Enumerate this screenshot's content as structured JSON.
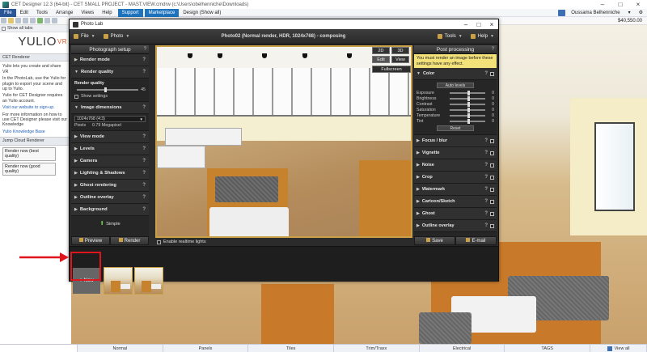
{
  "app": {
    "title": "CET Designer 12.3 (64-bit) - CET SMALL PROJECT - MAST.VIEW.cmdrw (c:\\Users\\obelhenniche\\Downloads)",
    "menus": [
      "File",
      "Edit",
      "Tools",
      "Arrange",
      "Views",
      "Help"
    ],
    "support_label": "Support",
    "marketplace_label": "Marketplace",
    "design_label": "Design (Show all)",
    "user_name": "Oussama Belhenniche",
    "amount": "$40,550.00",
    "show_all_tabs": "Show all tabs"
  },
  "left_panel": {
    "logo": "YULIO",
    "logo_suffix": "VR",
    "cet_renderer_header": "CET Renderer",
    "intro": "Yulio lets you create and share VR",
    "photolab_text": "In the PhotoLab, use the Yulio for plugin to export your scene and up to Yulio.",
    "requires_text": "Yulio for CET Designer requires an Yulio account.",
    "visit_link": "Visit our website to sign-up.",
    "more_info": "For more information on how to use CET Designer please visit our Knowledge",
    "kb_link": "Yulio Knowledge Base",
    "jump_header": "Jump Cloud Renderer",
    "render_best": "Render now (best quality)",
    "render_good": "Render now (good quality)"
  },
  "photolab": {
    "window_title": "Photo Lab",
    "file_label": "File",
    "photo_label": "Photo",
    "doc_title": "Photo02 (Normal render, HDR, 1024x768) - composing",
    "tools_label": "Tools",
    "help_label": "Help",
    "setup_header": "Photograph setup",
    "sections": [
      {
        "label": "Render mode"
      },
      {
        "label": "Render quality"
      },
      {
        "label": "Image dimensions"
      },
      {
        "label": "View mode"
      },
      {
        "label": "Levels"
      },
      {
        "label": "Camera"
      },
      {
        "label": "Lighting & Shadows"
      },
      {
        "label": "Ghost rendering"
      },
      {
        "label": "Outline overlay"
      },
      {
        "label": "Background"
      }
    ],
    "render_quality_label": "Render quality",
    "render_quality_value": "45",
    "render_quality_fraction": 0.45,
    "show_settings": "Show settings",
    "dimensions_value": "1024x768 (4:3)",
    "pixels_label": "Pixels",
    "pixels_value": "0.79 Megapixel",
    "simple_label": "Simple",
    "preview_label": "Preview",
    "render_label": "Render",
    "view_2d": "2D",
    "view_3d": "3D",
    "edit_label": "Edit",
    "view_label": "View",
    "fullscreen_label": "Fullscreen",
    "realtime_label": "Enable realtime lights",
    "post_header": "Post processing",
    "post_warning": "You must render an image before these settings have any effect.",
    "color_section": "Color",
    "auto_levels": "Auto levels",
    "color_rows": [
      {
        "label": "Exposure",
        "value": "0"
      },
      {
        "label": "Brightness",
        "value": "0"
      },
      {
        "label": "Contrast",
        "value": "0"
      },
      {
        "label": "Saturation",
        "value": "0"
      },
      {
        "label": "Temperature",
        "value": "0"
      },
      {
        "label": "Tint",
        "value": "0"
      }
    ],
    "reset_label": "Reset",
    "post_sections": [
      {
        "label": "Focus / blur"
      },
      {
        "label": "Vignette"
      },
      {
        "label": "Noise"
      },
      {
        "label": "Crop"
      },
      {
        "label": "Watermark"
      },
      {
        "label": "Cartoon/Sketch"
      },
      {
        "label": "Ghost"
      },
      {
        "label": "Outline overlay"
      }
    ],
    "save_label": "Save",
    "email_label": "E-mail",
    "new_label": "New"
  },
  "statusbar": {
    "tabs": [
      "Normal",
      "Panels",
      "Tiles",
      "Trim/Traxx",
      "Electrical",
      "TAGS"
    ],
    "view_all": "View all"
  },
  "colors": {
    "accent": "#c9a047",
    "annotation": "#e0141c",
    "panel_bg": "#262626"
  },
  "icons": [
    "file-icon",
    "photo-icon",
    "tools-icon",
    "help-icon",
    "preview-icon",
    "render-icon",
    "save-icon",
    "email-icon",
    "plus-icon",
    "arrow-right-icon"
  ]
}
